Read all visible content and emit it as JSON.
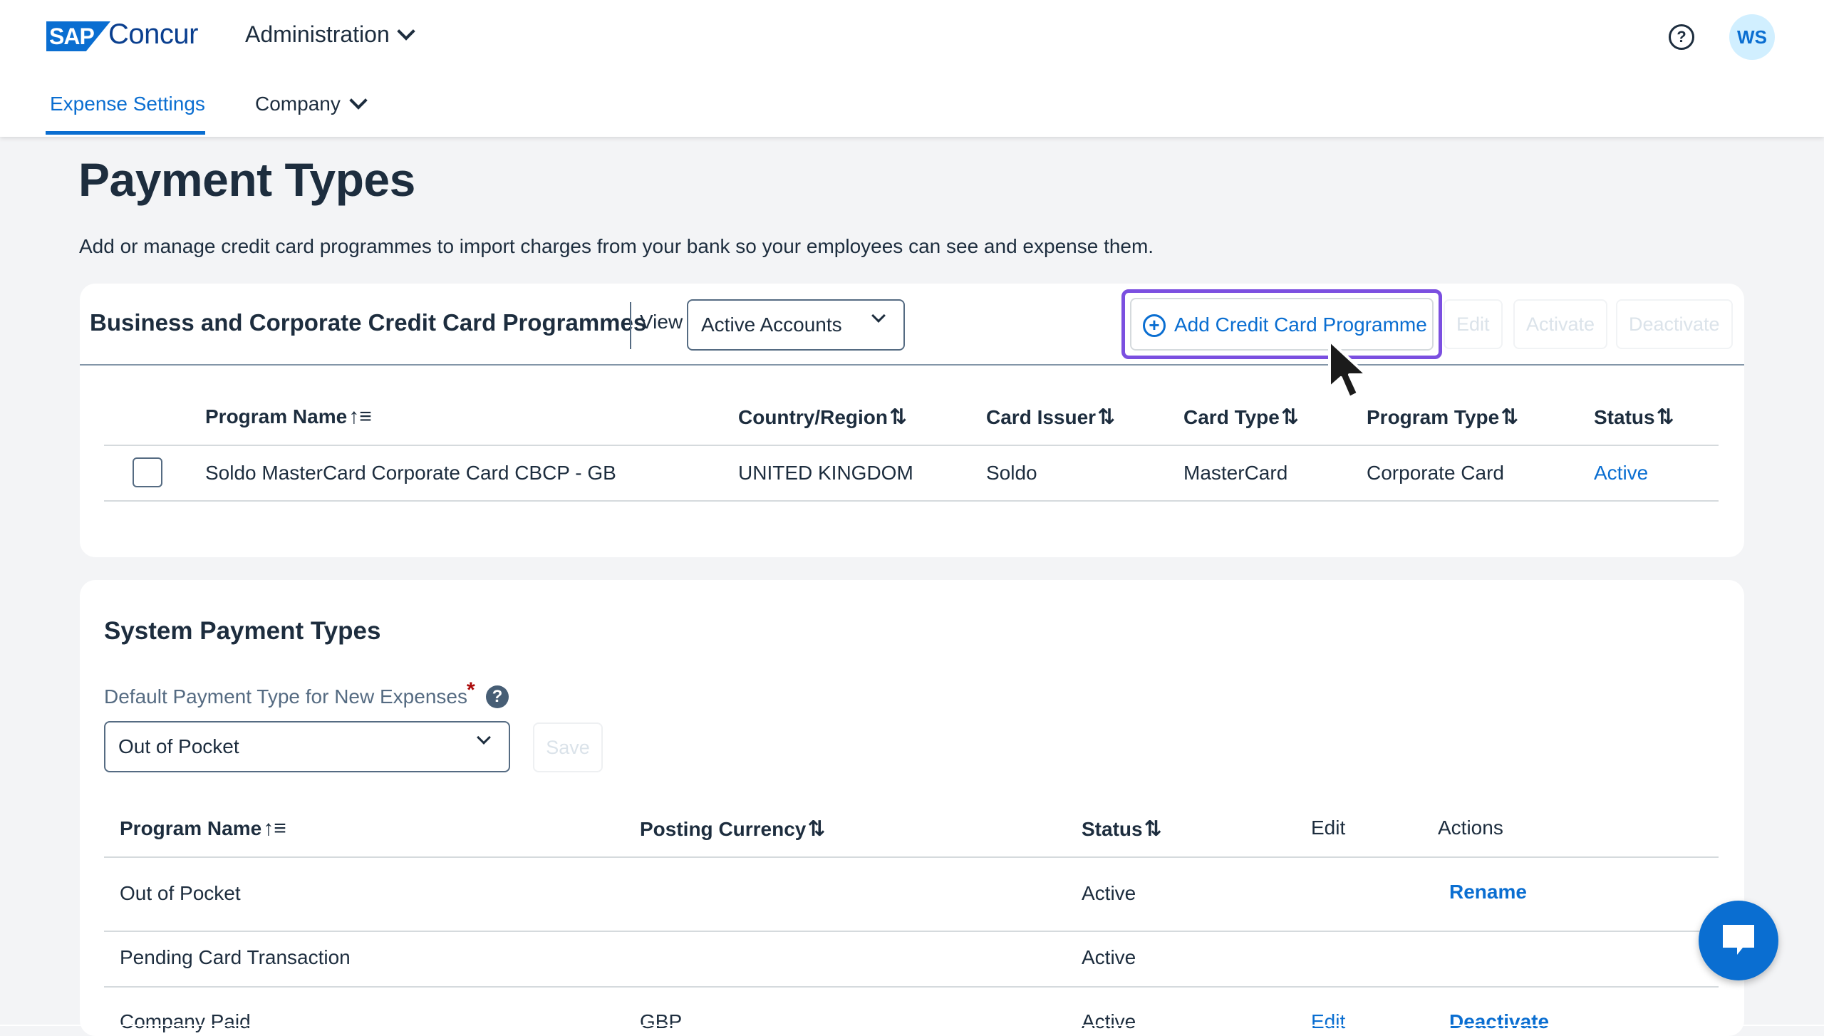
{
  "header": {
    "logo_sap": "SAP",
    "logo_concur": "Concur",
    "admin_menu": "Administration",
    "avatar_initials": "WS",
    "nav": {
      "expense_settings": "Expense Settings",
      "company": "Company"
    }
  },
  "page": {
    "title": "Payment Types",
    "description": "Add or manage credit card programmes to import charges from your bank so your employees can see and expense them."
  },
  "card_programmes": {
    "title": "Business and Corporate Credit Card Programmes",
    "view_label": "View",
    "view_value": "Active Accounts",
    "add_button": "Add Credit Card Programme",
    "edit_button": "Edit",
    "activate_button": "Activate",
    "deactivate_button": "Deactivate",
    "columns": {
      "program_name": "Program Name",
      "country": "Country/Region",
      "issuer": "Card Issuer",
      "card_type": "Card Type",
      "program_type": "Program Type",
      "status": "Status"
    },
    "rows": [
      {
        "program_name": "Soldo MasterCard Corporate Card CBCP - GB",
        "country": "UNITED KINGDOM",
        "issuer": "Soldo",
        "card_type": "MasterCard",
        "program_type": "Corporate Card",
        "status": "Active"
      }
    ]
  },
  "system_payment_types": {
    "title": "System Payment Types",
    "default_label": "Default Payment Type for New Expenses",
    "required_mark": "*",
    "default_value": "Out of Pocket",
    "save_button": "Save",
    "columns": {
      "program_name": "Program Name",
      "posting_currency": "Posting Currency",
      "status": "Status",
      "edit": "Edit",
      "actions": "Actions"
    },
    "rows": [
      {
        "program_name": "Out of Pocket",
        "currency": "",
        "status": "Active",
        "edit": "",
        "action": "Rename"
      },
      {
        "program_name": "Pending Card Transaction",
        "currency": "",
        "status": "Active",
        "edit": "",
        "action": ""
      },
      {
        "program_name": "Company Paid",
        "currency": "GBP",
        "status": "Active",
        "edit": "Edit",
        "action": "Deactivate"
      }
    ]
  },
  "icons": {
    "help": "help-circle-icon",
    "chat": "chat-bubble-icon",
    "info": "question-info-icon",
    "sort": "sort-arrows-icon",
    "cursor": "mouse-pointer-icon"
  },
  "colors": {
    "accent": "#0a6ed1",
    "highlight": "#7b4fe0",
    "required": "#aa0808",
    "text": "#1d2d3e"
  }
}
